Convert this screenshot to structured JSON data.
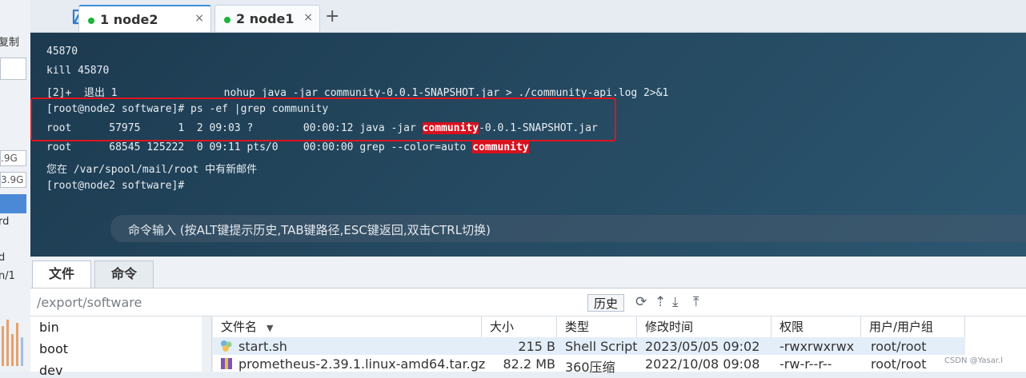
{
  "left_strip": {
    "copy_label": "复制",
    "size1": ".9G",
    "size2": "3.9G",
    "frag1": "rd",
    "frag2": "d",
    "frag3": "n/1"
  },
  "tabs": [
    {
      "label": "1 node2",
      "close": "×"
    },
    {
      "label": "2 node1",
      "close": "×"
    }
  ],
  "new_tab": "+",
  "terminal": {
    "lines": [
      "45870",
      "kill 45870",
      "[2]+  退出 1                 nohup java -jar community-0.0.1-SNAPSHOT.jar > ./community-api.log 2>&1",
      "[root@node2 software]# ps -ef |grep community",
      "root      57975      1  2 09:03 ?        00:00:12 java -jar ",
      "root      68545 125222  0 09:11 pts/0    00:00:00 grep --color=auto ",
      "您在 /var/spool/mail/root 中有新邮件",
      "[root@node2 software]#"
    ],
    "highlight_word": "community",
    "line5_suffix": "-0.0.1-SNAPSHOT.jar",
    "command_placeholder": "命令输入 (按ALT键提示历史,TAB键路径,ESC键返回,双击CTRL切换)",
    "grip": "....",
    "colors": {
      "highlight_bg": "#d8111e",
      "box": "#e0141e"
    }
  },
  "panel": {
    "tabs": [
      "文件",
      "命令"
    ],
    "path": "/export/software",
    "history_button": "历史",
    "tree": [
      "bin",
      "boot",
      "dev"
    ],
    "columns": [
      "文件名",
      "大小",
      "类型",
      "修改时间",
      "权限",
      "用户/用户组"
    ],
    "files": [
      {
        "name": "start.sh",
        "size": "215 B",
        "type": "Shell Script",
        "mtime": "2023/05/05 09:02",
        "perm": "-rwxrwxrwx",
        "owner": "root/root"
      },
      {
        "name": "prometheus-2.39.1.linux-amd64.tar.gz",
        "size": "82.2 MB",
        "type": "360压缩",
        "mtime": "2022/10/08 09:08",
        "perm": "-rw-r--r--",
        "owner": "root/root"
      }
    ]
  },
  "credit": "CSDN @Yasar.l"
}
